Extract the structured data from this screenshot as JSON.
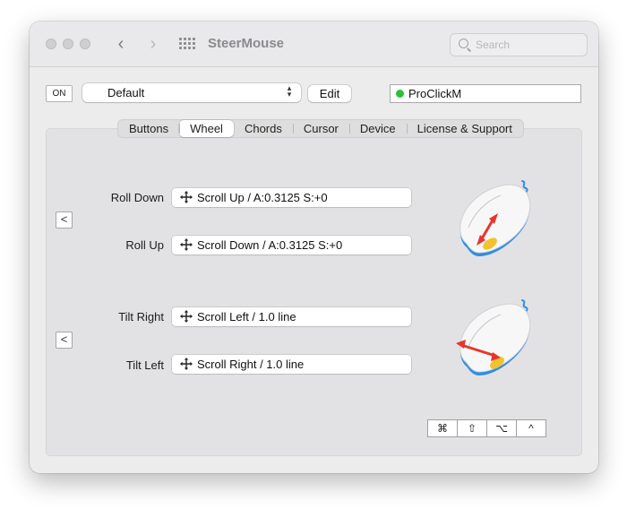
{
  "window": {
    "title": "SteerMouse"
  },
  "search": {
    "placeholder": "Search"
  },
  "toolbar": {
    "power_label": "ON",
    "profile_value": "Default",
    "edit_label": "Edit",
    "device_name": "ProClickM",
    "device_status_color": "#29c33a"
  },
  "tabs": [
    {
      "label": "Buttons"
    },
    {
      "label": "Wheel",
      "active": true
    },
    {
      "label": "Chords"
    },
    {
      "label": "Cursor"
    },
    {
      "label": "Device"
    },
    {
      "label": "License & Support"
    }
  ],
  "wheel_section": {
    "collapse_label": "<",
    "rows": [
      {
        "label": "Roll Down",
        "action": "Scroll Up / A:0.3125 S:+0"
      },
      {
        "label": "Roll Up",
        "action": "Scroll Down / A:0.3125 S:+0"
      }
    ]
  },
  "tilt_section": {
    "collapse_label": "<",
    "rows": [
      {
        "label": "Tilt Right",
        "action": "Scroll Left / 1.0 line"
      },
      {
        "label": "Tilt Left",
        "action": "Scroll Right / 1.0 line"
      }
    ]
  },
  "modifiers": [
    {
      "symbol": "⌘",
      "icon": "command-icon"
    },
    {
      "symbol": "⇧",
      "icon": "shift-icon"
    },
    {
      "symbol": "⌥",
      "icon": "option-icon"
    },
    {
      "symbol": "^",
      "icon": "control-icon"
    }
  ],
  "colors": {
    "arrow_red": "#e8352b",
    "mouse_accent_blue": "#2f8de4",
    "wheel_yellow": "#f2c230"
  }
}
